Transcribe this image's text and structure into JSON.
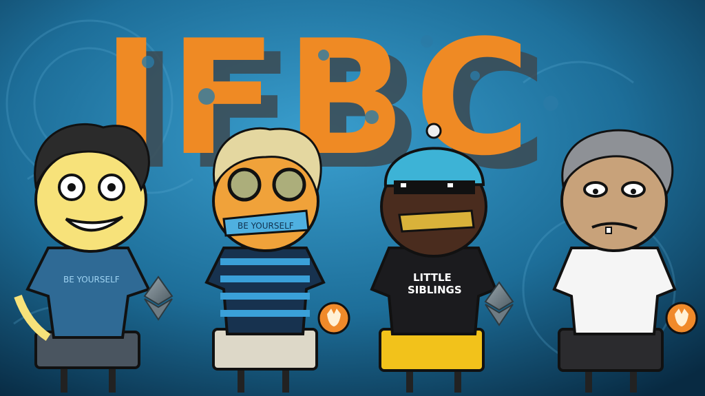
{
  "logo": {
    "text": "IFBC",
    "color": "#ef8a24",
    "shadow": "#3c4a52"
  },
  "background": {
    "top": "#2e8dbd",
    "bottom": "#0a2f48"
  },
  "characters": [
    {
      "name": "boy-blue-tee",
      "shirt_text": "BE YOURSELF",
      "item": "ethereum-icon"
    },
    {
      "name": "curly-striped",
      "tape_text": "BE YOURSELF",
      "item": "shiba-coin-icon"
    },
    {
      "name": "beanie-shades",
      "shirt_text_line1": "LITTLE",
      "shirt_text_line2": "SIBLINGS",
      "item": "ethereum-icon"
    },
    {
      "name": "grey-hair-white-tee",
      "item": "shiba-coin-icon"
    }
  ]
}
